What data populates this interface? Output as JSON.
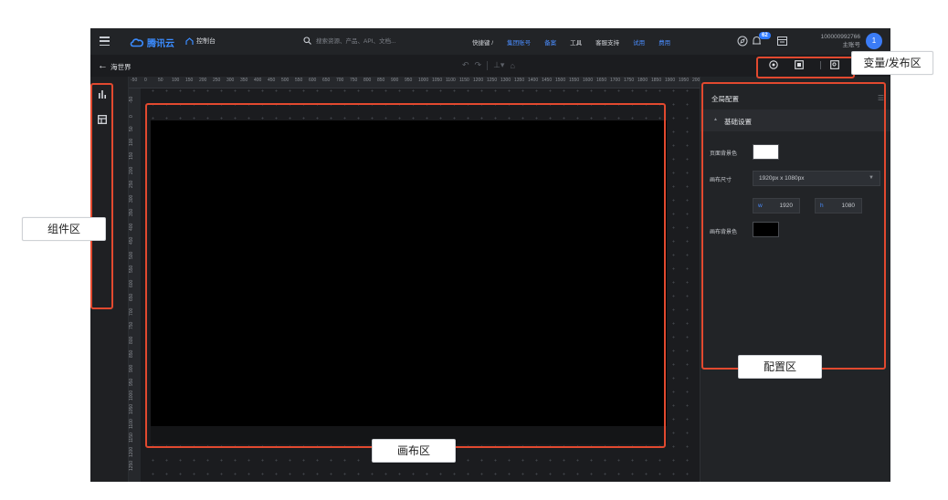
{
  "topnav": {
    "brand": "腾讯云",
    "console": "控制台",
    "search_placeholder": "搜索资源、产品、API、文档...",
    "links": [
      {
        "label": "快捷键 /",
        "style": "white"
      },
      {
        "label": "集团账号",
        "style": "blue"
      },
      {
        "label": "备案",
        "style": "blue"
      },
      {
        "label": "工具",
        "style": "white"
      },
      {
        "label": "客服支持",
        "style": "white"
      },
      {
        "label": "试用",
        "style": "blue"
      },
      {
        "label": "费用",
        "style": "blue"
      }
    ],
    "notification_count": "62",
    "account_id": "100000992766",
    "account_role": "主账号",
    "avatar_text": "1"
  },
  "editor": {
    "title": "海世界"
  },
  "ruler": {
    "top_ticks": [
      "-50",
      "0",
      "50",
      "100",
      "150",
      "200",
      "250",
      "300",
      "350",
      "400",
      "450",
      "500",
      "550",
      "600",
      "650",
      "700",
      "750",
      "800",
      "850",
      "900",
      "950",
      "1000",
      "1050",
      "1100",
      "1150",
      "1200",
      "1250",
      "1300",
      "1350",
      "1400",
      "1450",
      "1500",
      "1550",
      "1600",
      "1650",
      "1700",
      "1750",
      "1800",
      "1850",
      "1900",
      "1950",
      "2000"
    ],
    "left_ticks": [
      "-50",
      "0",
      "50",
      "100",
      "150",
      "200",
      "250",
      "300",
      "350",
      "400",
      "450",
      "500",
      "550",
      "600",
      "650",
      "700",
      "750",
      "800",
      "850",
      "900",
      "950",
      "1000",
      "1050",
      "1100",
      "1150",
      "1200",
      "1250"
    ]
  },
  "panel": {
    "title": "全局配置",
    "section": "基础设置",
    "page_bg_label": "页面背景色",
    "page_bg_color": "#ffffff",
    "canvas_size_label": "画布尺寸",
    "canvas_size_value": "1920px x 1080px",
    "width_prefix": "w",
    "width_value": "1920",
    "height_prefix": "h",
    "height_value": "1080",
    "canvas_bg_label": "画布背景色",
    "canvas_bg_color": "#000000"
  },
  "annotations": {
    "component_area": "组件区",
    "canvas_area": "画布区",
    "config_area": "配置区",
    "publish_area": "变量/发布区"
  },
  "colors": {
    "accent": "#3b8cff",
    "highlight": "#e2492f"
  }
}
